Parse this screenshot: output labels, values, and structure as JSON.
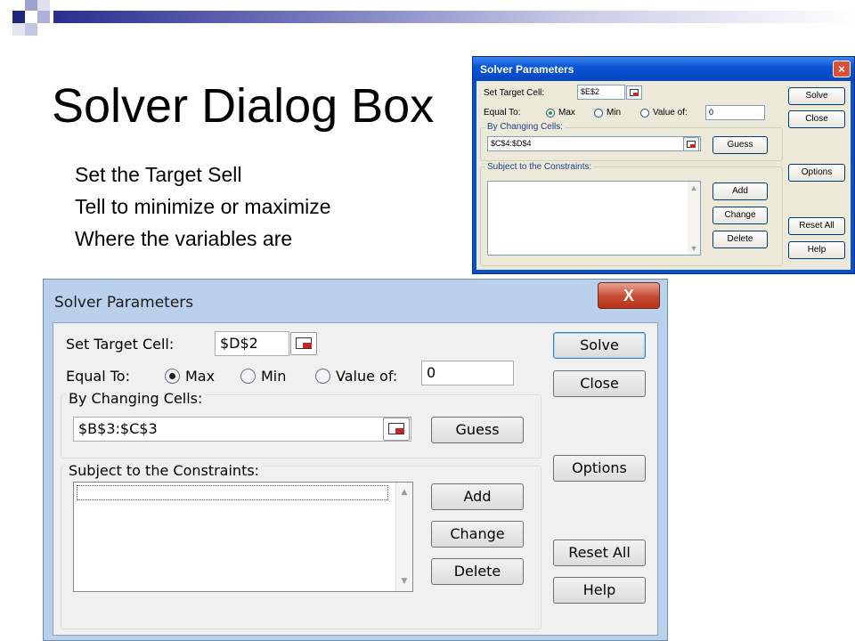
{
  "slide": {
    "title": "Solver Dialog Box",
    "bullets": [
      "Set the Target Sell",
      "Tell to minimize or maximize",
      "Where the variables are"
    ]
  },
  "small_dialog": {
    "title": "Solver Parameters",
    "close_glyph": "×",
    "set_target_label": "Set Target Cell:",
    "target_value": "$E$2",
    "equal_to_label": "Equal To:",
    "radio_max": "Max",
    "radio_min": "Min",
    "radio_value_of": "Value of:",
    "value_of": "0",
    "changing_cells_label": "By Changing Cells:",
    "changing_cells_value": "$C$4:$D$4",
    "constraints_label": "Subject to the Constraints:",
    "buttons": {
      "solve": "Solve",
      "close": "Close",
      "guess": "Guess",
      "add": "Add",
      "change": "Change",
      "delete": "Delete",
      "options": "Options",
      "reset_all": "Reset All",
      "help": "Help"
    }
  },
  "large_dialog": {
    "title": "Solver Parameters",
    "close_glyph": "X",
    "set_target_label": "Set Target Cell:",
    "target_value": "$D$2",
    "equal_to_label": "Equal To:",
    "radio_max": "Max",
    "radio_min": "Min",
    "radio_value_of": "Value of:",
    "value_of": "0",
    "changing_cells_label": "By Changing Cells:",
    "changing_cells_value": "$B$3:$C$3",
    "constraints_label": "Subject to the Constraints:",
    "buttons": {
      "solve": "Solve",
      "close": "Close",
      "guess": "Guess",
      "add": "Add",
      "change": "Change",
      "delete": "Delete",
      "options": "Options",
      "reset_all": "Reset All",
      "help": "Help"
    }
  },
  "colors": {
    "title_bar_xp": "#0b56d6",
    "win7_frame": "#b9d1ea",
    "close_red": "#c74a32",
    "accent_navy": "#2b2e8c"
  },
  "icons": {
    "range_select": "range-select-icon",
    "scroll_up": "scroll-up-arrow-icon",
    "scroll_down": "scroll-down-arrow-icon"
  }
}
